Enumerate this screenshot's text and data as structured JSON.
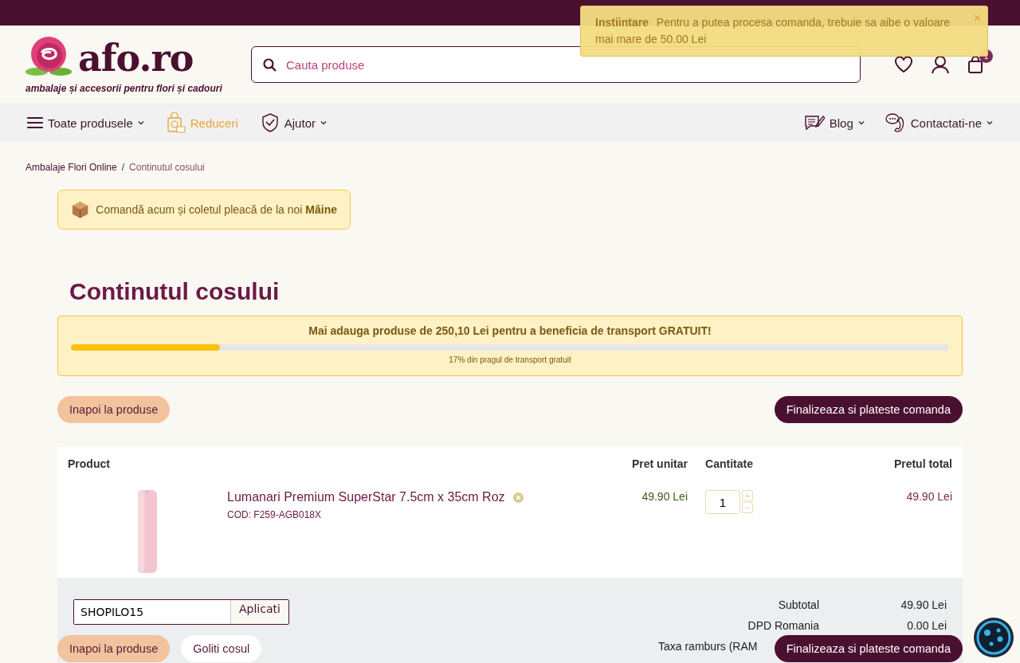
{
  "toast": {
    "title": "Instiintare",
    "close": "×",
    "message": "Pentru a putea procesa comanda, trebuie sa aibe o valoare mai mare de 50.00  Lei"
  },
  "header": {
    "logo": "afo.ro",
    "tagline": "ambalaje și accesorii pentru flori și cadouri",
    "search": {
      "placeholder": "Cauta produse"
    },
    "cart_count": "1"
  },
  "nav": {
    "left": [
      {
        "label": "Toate produsele",
        "kind": "menu",
        "dropdown": true
      },
      {
        "label": "Reduceri",
        "kind": "sale",
        "dropdown": false
      },
      {
        "label": "Ajutor",
        "kind": "help",
        "dropdown": true
      }
    ],
    "right": [
      {
        "label": "Blog",
        "kind": "blog",
        "dropdown": true
      },
      {
        "label": "Contactati-ne",
        "kind": "contact",
        "dropdown": true
      }
    ]
  },
  "breadcrumb": [
    {
      "label": "Ambalaje Flori Online"
    },
    {
      "label": "Continutul cosului"
    }
  ],
  "breadcrumb_separator": "/",
  "delivery_notice": "Comandă acum și coletul pleacă de la noi **Mâine**",
  "title": "Continutul cosului",
  "shipping": {
    "message": "Mai adauga produse de 250,10 Lei pentru a beneficia de transport GRATUIT!",
    "level": 0.17,
    "caption": "17% din pragul de transport gratuit"
  },
  "actions": {
    "back": "Inapoi la produse",
    "checkout": "Finalizeaza si plateste comanda"
  },
  "table": {
    "columns": [
      "Product",
      "Pret unitar",
      "Cantitate",
      "Pretul total"
    ],
    "rows": [
      {
        "name": "Lumanari Premium SuperStar 7.5cm x 35cm Roz",
        "code": "COD: F259-AGB018X",
        "unit_price": "49.90  Lei",
        "quantity": "1",
        "increase": "+",
        "decrease": "−",
        "total": "49.90  Lei"
      }
    ]
  },
  "coupon": {
    "value": "SHOPILO15",
    "button": "Aplicati"
  },
  "summary": [
    {
      "label": "Subtotal",
      "value": "49.90  Lei"
    },
    {
      "label": "DPD Romania",
      "value": "0.00  Lei"
    },
    {
      "label": "Taxa ramburs (RAM"
    }
  ],
  "bottom_bar": {
    "back": "Inapoi la produse",
    "clear": "Goliti cosul",
    "checkout": "Finalizeaza si plateste comanda"
  }
}
